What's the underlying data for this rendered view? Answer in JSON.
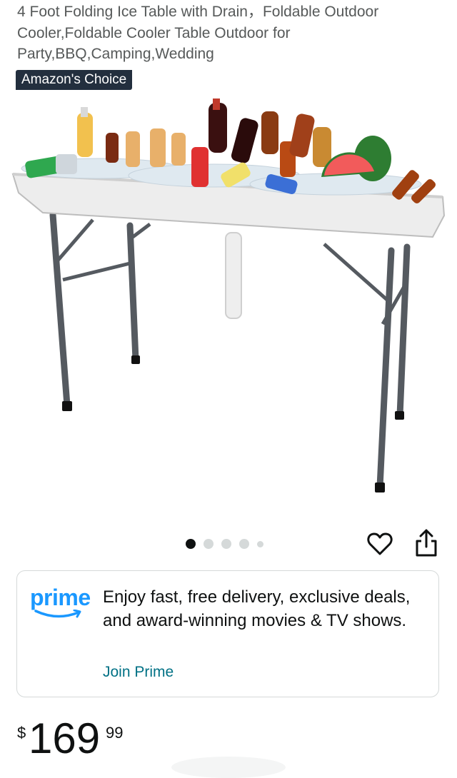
{
  "product": {
    "title": "4 Foot Folding Ice Table with Drain，Foldable Outdoor Cooler,Foldable Cooler Table Outdoor for Party,BBQ,Camping,Wedding",
    "badge": "Amazon's Choice"
  },
  "image_carousel": {
    "image_count": 5,
    "active_index": 0
  },
  "actions": {
    "heart_icon": "heart-outline-icon",
    "share_icon": "share-icon"
  },
  "prime": {
    "logo_text": "prime",
    "message": "Enjoy fast, free delivery, exclusive deals, and award-winning movies & TV shows.",
    "cta": "Join Prime"
  },
  "price": {
    "symbol": "$",
    "whole": "169",
    "fraction": "99"
  },
  "colors": {
    "badge_bg": "#232f3e",
    "prime_blue": "#1a98ff",
    "link_teal": "#007185",
    "title_gray": "#565959",
    "border_gray": "#d5d9d9"
  }
}
